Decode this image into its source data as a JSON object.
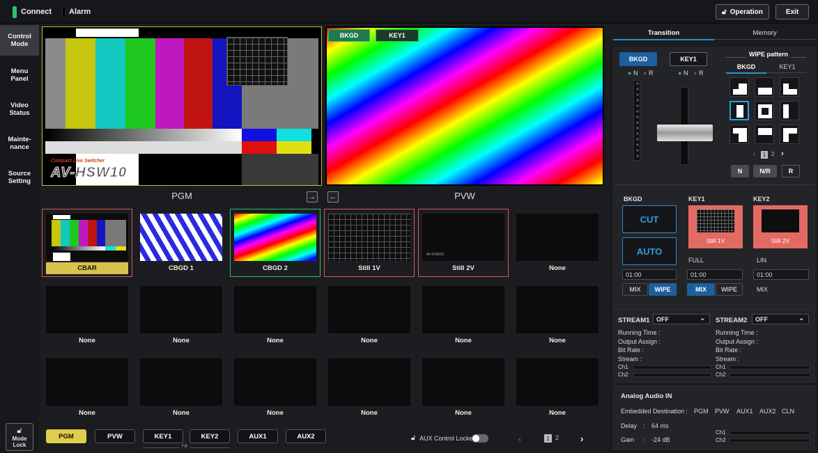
{
  "topbar": {
    "connect": "Connect",
    "alarm": "Alarm",
    "operation": "Operation",
    "exit": "Exit"
  },
  "nav": [
    {
      "label": "Control\nMode",
      "active": true
    },
    {
      "label": "Menu\nPanel",
      "active": false
    },
    {
      "label": "Video\nStatus",
      "active": false
    },
    {
      "label": "Mainte-\nnance",
      "active": false
    },
    {
      "label": "Source\nSetting",
      "active": false
    }
  ],
  "mode_lock": "Mode\nLock",
  "monitors": {
    "pgm_label": "PGM",
    "pvw_label": "PVW",
    "pvw_tabs": [
      "BKGD",
      "KEY1"
    ],
    "cbar_brand_small": "Compact Live Switcher",
    "cbar_brand": "AV-HSW10"
  },
  "sources": [
    [
      "CBAR",
      "CBGD 1",
      "CBGD 2",
      "Still 1V",
      "Still 2V",
      "None"
    ],
    [
      "None",
      "None",
      "None",
      "None",
      "None",
      "None"
    ],
    [
      "None",
      "None",
      "None",
      "None",
      "None",
      "None"
    ]
  ],
  "bus": {
    "buttons": [
      "PGM",
      "PVW",
      "KEY1",
      "KEY2",
      "AUX1",
      "AUX2"
    ],
    "fill": "Fill",
    "aux_locked": "AUX Control Locked",
    "pages": [
      "1",
      "2"
    ]
  },
  "right": {
    "tabs": [
      "Transition",
      "Memory"
    ],
    "bkgd": "BKGD",
    "key1": "KEY1",
    "key2": "KEY2",
    "n": "N",
    "r": "R",
    "wipe_title": "WIPE pattern",
    "wipe_tabs": [
      "BKGD",
      "KEY1"
    ],
    "wipe_pages": [
      "1",
      "2"
    ],
    "nnr": [
      "N",
      "N/R",
      "R"
    ],
    "cut": "CUT",
    "auto": "AUTO",
    "key1_src": "Still 1V",
    "key2_src": "Still 2V",
    "key1_type": "FULL",
    "key2_type": "LIN",
    "times": [
      "01:00",
      "01:00",
      "01:00"
    ],
    "mix": "MIX",
    "wipe": "WIPE",
    "stream1": "STREAM1",
    "stream2": "STREAM2",
    "stream_val": "OFF",
    "stream_fields": [
      "Running Time :",
      "Output Assign :",
      "Bit Rate :",
      "Stream :"
    ],
    "ch1": "Ch1",
    "ch2": "Ch2",
    "audio_title": "Analog Audio IN",
    "embedded": "Embedded Destination :",
    "dest": [
      "PGM",
      "PVW",
      "AUX1",
      "AUX2",
      "CLN"
    ],
    "delay_lbl": "Delay",
    "delay_val": "64 ms",
    "gain_lbl": "Gain",
    "gain_val": "-24 dB",
    "colon": ":"
  }
}
